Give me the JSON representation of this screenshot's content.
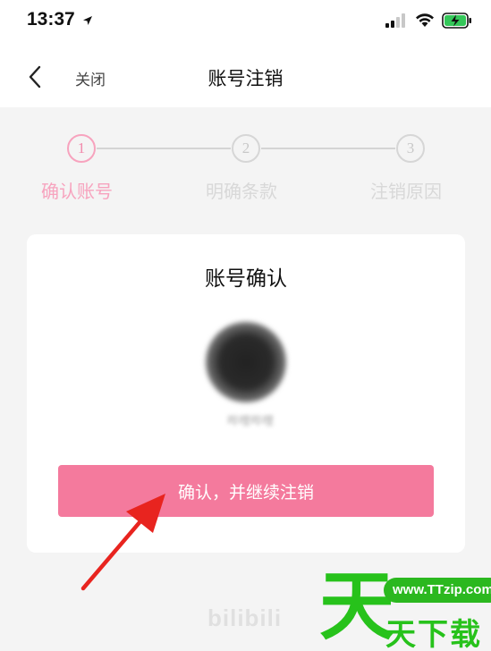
{
  "status_bar": {
    "time": "13:37"
  },
  "nav": {
    "close_label": "关闭",
    "title": "账号注销"
  },
  "steps": [
    {
      "number": "1",
      "label": "确认账号",
      "active": true
    },
    {
      "number": "2",
      "label": "明确条款",
      "active": false
    },
    {
      "number": "3",
      "label": "注销原因",
      "active": false
    }
  ],
  "card": {
    "title": "账号确认",
    "username": "哔哩哔哩",
    "confirm_button_label": "确认，并继续注销"
  },
  "watermarks": {
    "bilibili": "bilibili",
    "site_url": "www.TTzip.com",
    "site_char": "天",
    "site_name": "天下载"
  },
  "colors": {
    "accent_pink": "#f47a9d",
    "step_active": "#f7a3be",
    "step_inactive": "#d8d8d8",
    "annotation_red": "#e8241f",
    "logo_green": "#27c21b"
  }
}
